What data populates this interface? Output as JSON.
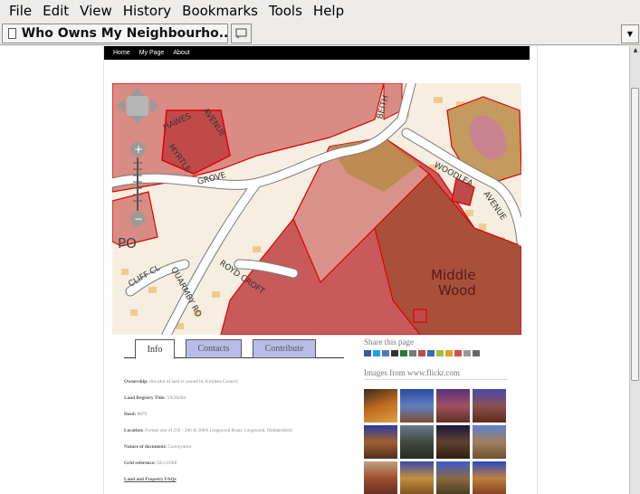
{
  "menubar": {
    "items": [
      "File",
      "Edit",
      "View",
      "History",
      "Bookmarks",
      "Tools",
      "Help"
    ]
  },
  "tab": {
    "title": "Who Owns My Neighbourho..."
  },
  "topnav": {
    "links": [
      "Home",
      "My Page",
      "About"
    ]
  },
  "map": {
    "labels": {
      "hawes": "HAWES",
      "avenue1": "AVENUE",
      "myrtle": "MYRTLE",
      "grove": "GROVE",
      "woodlea": "WOODLEA",
      "avenue2": "AVENUE",
      "royd": "ROYD CROFT",
      "cliff": "CLIFF CL",
      "quarmby": "QUARMBY RO",
      "po": "PO",
      "middle": "Middle",
      "wood": "Wood",
      "beith": "BEITH"
    }
  },
  "info_tabs": {
    "info": "Info",
    "contacts": "Contacts",
    "contribute": "Contribute"
  },
  "details": {
    "ownership_label": "Ownership:",
    "ownership_value": "this plot of land is owned by Kirklees Council",
    "title_label": "Land Registry Title:",
    "title_value": "YK20464",
    "deed_label": "Deed:",
    "deed_value": "6879",
    "location_label": "Location:",
    "location_value": "Former site of 256 - 266 & 268A Longwood Road, Longwood, Huddersfield",
    "nature_label": "Nature of document:",
    "nature_value": "Conveyance",
    "grid_label": "Grid reference:",
    "grid_value": "SE1116SE",
    "faq": "Land and Property FAQs"
  },
  "share": {
    "title": "Share this page"
  },
  "flickr": {
    "title": "Images from www.flickr.com"
  },
  "colors": {
    "tab_inactive": "#b8bce8",
    "map_red": "#e00000",
    "map_bg": "#f6efe1"
  }
}
